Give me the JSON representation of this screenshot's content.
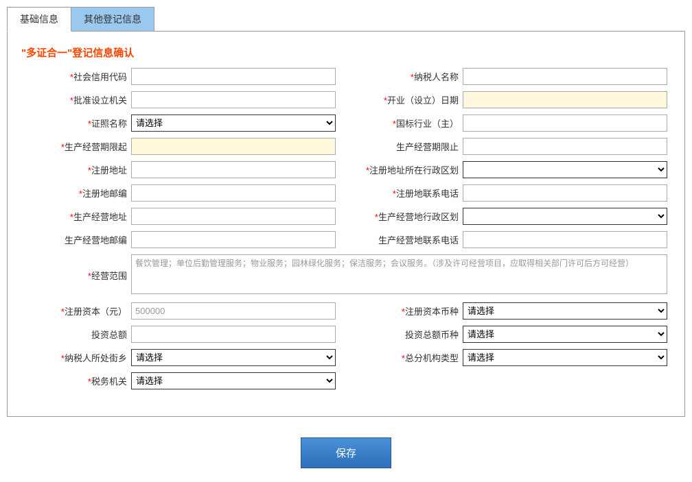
{
  "tabs": {
    "active": "基础信息",
    "inactive": "其他登记信息"
  },
  "form_title": "\"多证合一\"登记信息确认",
  "labels": {
    "social_credit_code": "社会信用代码",
    "taxpayer_name": "纳税人名称",
    "approval_authority": "批准设立机关",
    "open_date": "开业（设立）日期",
    "license_name": "证照名称",
    "national_industry": "国标行业（主）",
    "operation_start": "生产经营期限起",
    "operation_end": "生产经营期限止",
    "reg_address": "注册地址",
    "reg_admin_division": "注册地址所在行政区划",
    "reg_postcode": "注册地邮编",
    "reg_phone": "注册地联系电话",
    "biz_address": "生产经营地址",
    "biz_admin_division": "生产经营地行政区划",
    "biz_postcode": "生产经营地邮编",
    "biz_phone": "生产经营地联系电话",
    "business_scope": "经营范围",
    "reg_capital": "注册资本（元）",
    "reg_capital_currency": "注册资本币种",
    "total_investment": "投资总额",
    "investment_currency": "投资总额币种",
    "taxpayer_street": "纳税人所处街乡",
    "org_type": "总分机构类型",
    "tax_authority": "税务机关"
  },
  "values": {
    "social_credit_code": "",
    "taxpayer_name": "",
    "approval_authority": "",
    "open_date": "",
    "license_name": "请选择",
    "national_industry": "",
    "operation_start": "",
    "operation_end": "",
    "reg_address": "",
    "reg_admin_division_placeholder": "",
    "reg_postcode": "",
    "reg_phone": "",
    "biz_address": "",
    "biz_admin_division_placeholder": "",
    "biz_postcode": "",
    "biz_phone": "",
    "business_scope": "餐饮管理；单位后勤管理服务；物业服务；园林绿化服务；保洁服务；会议服务。（涉及许可经营项目，应取得相关部门许可后方可经营）",
    "reg_capital": "500000",
    "reg_capital_currency": "请选择",
    "total_investment": "",
    "investment_currency": "请选择",
    "taxpayer_street": "请选择",
    "org_type": "请选择",
    "tax_authority": "请选择"
  },
  "buttons": {
    "save": "保存"
  }
}
